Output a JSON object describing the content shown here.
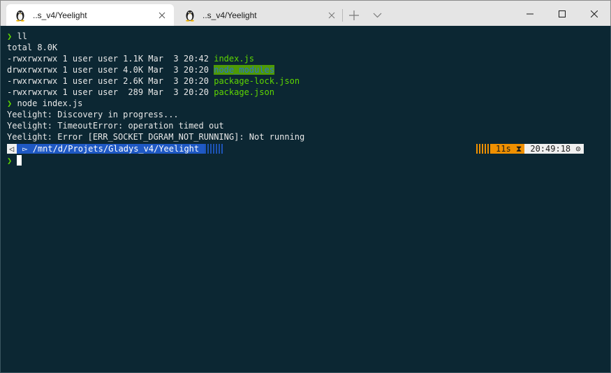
{
  "tabs": [
    {
      "label": "..s_v4/Yeelight",
      "icon": "tux-icon",
      "active": true,
      "close": "✕"
    },
    {
      "label": "..s_v4/Yeelight",
      "icon": "tux-icon",
      "active": false,
      "close": "✕"
    }
  ],
  "tabbar": {
    "new_tab": "+",
    "dropdown": "⌄"
  },
  "window_controls": {
    "minimize": "—",
    "maximize": "☐",
    "close": "✕"
  },
  "terminal": {
    "cmd1": {
      "arrow": "❯",
      "text": "ll"
    },
    "total": "total 8.0K",
    "files": [
      {
        "meta": "-rwxrwxrwx 1 user user 1.1K Mar  3 20:42 ",
        "name": "index.js",
        "kind": "js"
      },
      {
        "meta": "drwxrwxrwx 1 user user 4.0K Mar  3 20:20 ",
        "name": "node_modules",
        "kind": "dir"
      },
      {
        "meta": "-rwxrwxrwx 1 user user 2.6K Mar  3 20:20 ",
        "name": "package-lock.json",
        "kind": "json"
      },
      {
        "meta": "-rwxrwxrwx 1 user user  289 Mar  3 20:20 ",
        "name": "package.json",
        "kind": "json"
      }
    ],
    "cmd2": {
      "arrow": "❯",
      "text": "node index.js"
    },
    "output": [
      "Yeelight: Discovery in progress...",
      "Yeelight: TimeoutError: operation timed out",
      "Yeelight: Error [ERR_SOCKET_DGRAM_NOT_RUNNING]: Not running"
    ],
    "prompt": {
      "os_glyph": "◁",
      "folder_glyph": "▻",
      "path": "/mnt/d/Projets/Gladys_v4/Yeelight",
      "duration": "11s",
      "duration_glyph": "⧗",
      "time": "20:49:18",
      "clock_glyph": "⊙"
    },
    "cmd3": {
      "arrow": "❯"
    }
  },
  "colors": {
    "background": "#0c2733",
    "prompt_green": "#5fd700",
    "path_blue": "#1f59c4",
    "duration_orange": "#f09000"
  }
}
